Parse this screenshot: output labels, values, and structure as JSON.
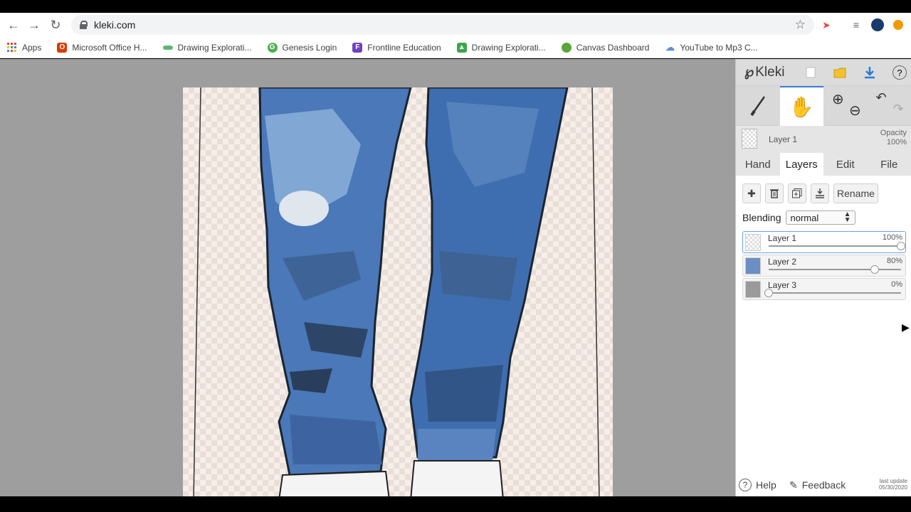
{
  "browser": {
    "url": "kleki.com",
    "bookmarks": [
      {
        "label": "Apps",
        "icon": "apps-grid-icon",
        "color": "#e8453c"
      },
      {
        "label": "Microsoft Office H...",
        "icon": "office-icon",
        "color": "#d83b01"
      },
      {
        "label": "Drawing Explorati...",
        "icon": "drawing-icon",
        "color": "#5bb974"
      },
      {
        "label": "Genesis Login",
        "icon": "genesis-icon",
        "color": "#4caf50"
      },
      {
        "label": "Frontline Education",
        "icon": "frontline-icon",
        "color": "#6f42c1"
      },
      {
        "label": "Drawing Explorati...",
        "icon": "drawing-icon",
        "color": "#3ca54a"
      },
      {
        "label": "Canvas Dashboard",
        "icon": "canvas-icon",
        "color": "#5aa63b"
      },
      {
        "label": "YouTube to Mp3 C...",
        "icon": "cloud-icon",
        "color": "#5f8fd6"
      }
    ]
  },
  "kleki": {
    "logo": "Kleki",
    "current_layer": "Layer 1",
    "opacity_label": "Opacity",
    "opacity_value": "100%",
    "tabs": [
      "Hand",
      "Layers",
      "Edit",
      "File"
    ],
    "active_tab": "Layers",
    "rename_label": "Rename",
    "blending_label": "Blending",
    "blending_value": "normal",
    "layers": [
      {
        "name": "Layer 1",
        "opacity": "100%",
        "level": 1.0,
        "selected": true
      },
      {
        "name": "Layer 2",
        "opacity": "80%",
        "level": 0.8,
        "selected": false
      },
      {
        "name": "Layer 3",
        "opacity": "0%",
        "level": 0.0,
        "selected": false
      }
    ],
    "help_label": "Help",
    "feedback_label": "Feedback",
    "last_update_label": "last update",
    "last_update_date": "05/30/2020"
  }
}
